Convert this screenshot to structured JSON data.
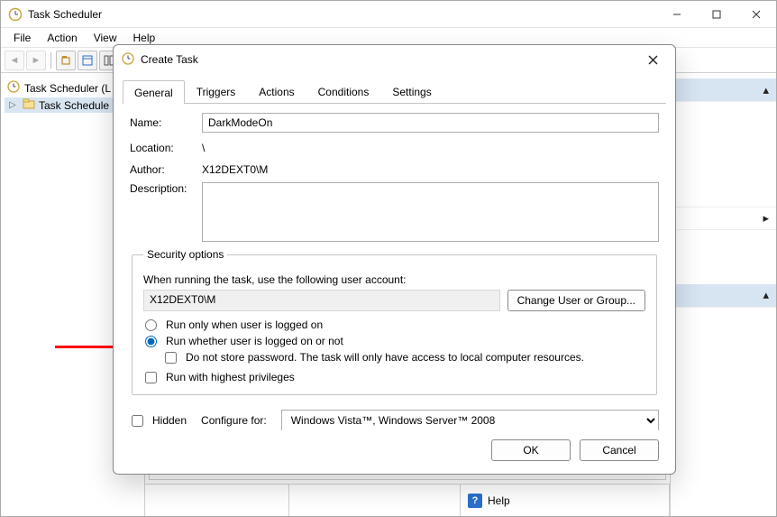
{
  "app": {
    "title": "Task Scheduler",
    "menu": {
      "file": "File",
      "action": "Action",
      "view": "View",
      "help": "Help"
    }
  },
  "tree": {
    "root": "Task Scheduler (L",
    "child": "Task Schedule"
  },
  "bottom": {
    "help": "Help"
  },
  "dialog": {
    "title": "Create Task",
    "tabs": {
      "general": "General",
      "triggers": "Triggers",
      "actions": "Actions",
      "conditions": "Conditions",
      "settings": "Settings"
    },
    "labels": {
      "name": "Name:",
      "location": "Location:",
      "author": "Author:",
      "description": "Description:"
    },
    "values": {
      "name": "DarkModeOn",
      "location": "\\",
      "author": "X12DEXT0\\M",
      "description": ""
    },
    "security": {
      "legend": "Security options",
      "when_running": "When running the task, use the following user account:",
      "account": "X12DEXT0\\M",
      "change_user": "Change User or Group...",
      "radio_logged_on": "Run only when user is logged on",
      "radio_whether": "Run whether user is logged on or not",
      "no_store_pw": "Do not store password.  The task will only have access to local computer resources.",
      "highest_priv": "Run with highest privileges"
    },
    "hidden_label": "Hidden",
    "configure_label": "Configure for:",
    "configure_value": "Windows Vista™, Windows Server™ 2008",
    "ok": "OK",
    "cancel": "Cancel"
  }
}
